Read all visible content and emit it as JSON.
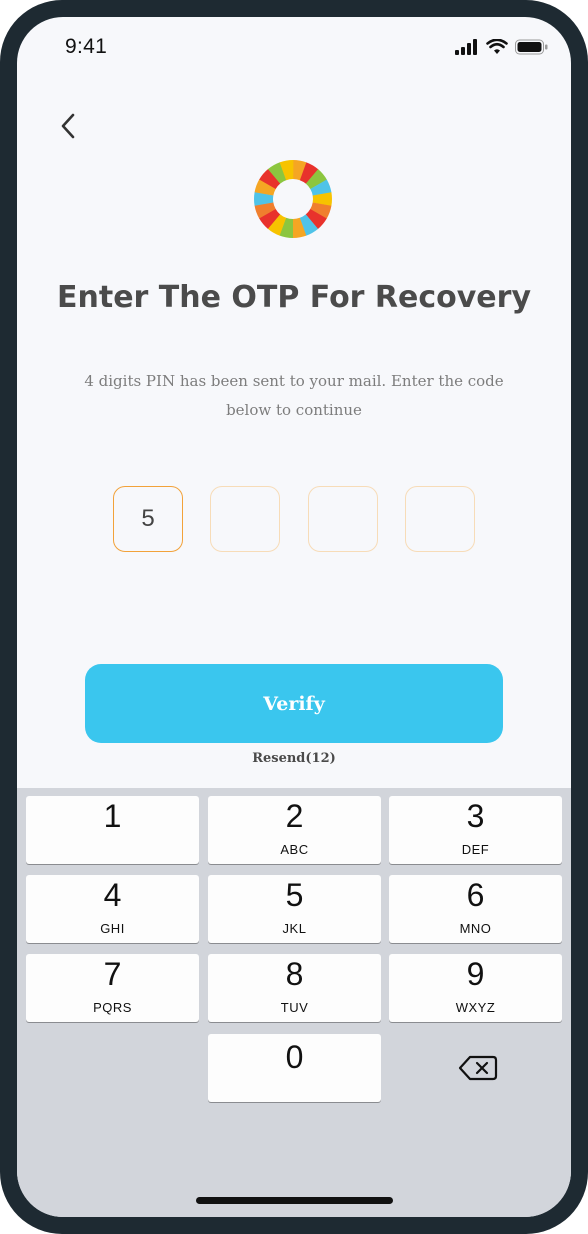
{
  "status_bar": {
    "time": "9:41"
  },
  "header": {
    "title": "Enter The OTP For Recovery",
    "subtitle": "4 digits PIN has been sent to your mail. Enter the code below to continue"
  },
  "otp": {
    "digits": [
      "5",
      "",
      "",
      ""
    ],
    "active_color": "#f2a23a",
    "inactive_color": "#f7dcb8"
  },
  "actions": {
    "verify_label": "Verify",
    "verify_color": "#3ac6ee",
    "resend_label": "Resend(12)"
  },
  "keypad": {
    "keys": [
      {
        "num": "1",
        "letters": ""
      },
      {
        "num": "2",
        "letters": "ABC"
      },
      {
        "num": "3",
        "letters": "DEF"
      },
      {
        "num": "4",
        "letters": "GHI"
      },
      {
        "num": "5",
        "letters": "JKL"
      },
      {
        "num": "6",
        "letters": "MNO"
      },
      {
        "num": "7",
        "letters": "PQRS"
      },
      {
        "num": "8",
        "letters": "TUV"
      },
      {
        "num": "9",
        "letters": "WXYZ"
      },
      {
        "num": "0",
        "letters": ""
      }
    ],
    "backspace_icon": "backspace-icon"
  },
  "icons": {
    "back": "chevron-left-icon",
    "logo": "colorful-ring-logo",
    "signal": "signal-icon",
    "wifi": "wifi-icon",
    "battery": "battery-icon"
  }
}
